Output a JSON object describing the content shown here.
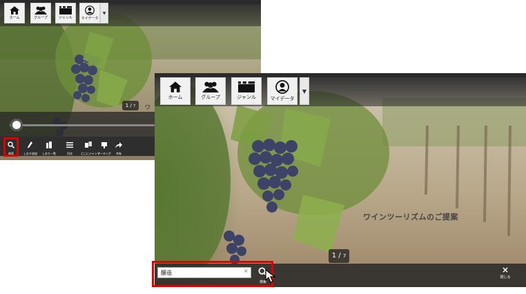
{
  "nav": {
    "home": "ホーム",
    "group": "グループ",
    "genre": "ジャンル",
    "mydata": "マイデータ",
    "dropdown": "▼"
  },
  "back": {
    "page_current": "1",
    "page_total": "7",
    "title_peek": "ワ",
    "tools": {
      "search": "検索",
      "tool2": "しおり追加",
      "tool3": "しおり一覧",
      "tool4": "目次",
      "tool5": "どこにジャンプ",
      "tool6": "マーキング",
      "tool7": "共有"
    }
  },
  "front": {
    "title": "ワインツーリズムのご提案",
    "page_current": "1",
    "page_total": "7",
    "search": {
      "value": "醸造",
      "clear": "×",
      "button_label": "検索"
    },
    "close_label": "閉じる",
    "close_icon": "×"
  },
  "colors": {
    "highlight": "#e00000",
    "toolbar": "#2e2e2e",
    "nav_button": "#f1f1f1"
  }
}
